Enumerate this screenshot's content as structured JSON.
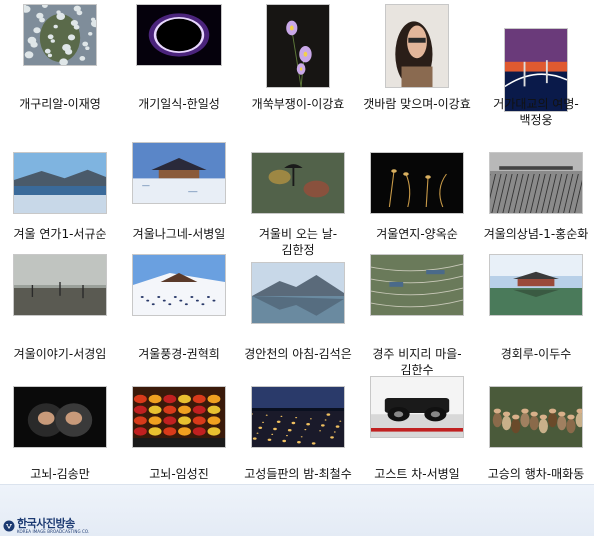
{
  "files": [
    {
      "label": "개구리알-이재영",
      "thumb": "frog-eggs"
    },
    {
      "label": "개기일식-한일성",
      "thumb": "eclipse"
    },
    {
      "label": "개쑥부쟁이-이강효",
      "thumb": "asters"
    },
    {
      "label": "갯바람 맞으며-이강효",
      "thumb": "woman-portrait"
    },
    {
      "label": "거가대교의 여명-백정웅",
      "thumb": "bridge-dawn"
    },
    {
      "label": "겨울 연가1-서규순",
      "thumb": "winter-lake"
    },
    {
      "label": "겨울나그네-서병일",
      "thumb": "snow-hanok"
    },
    {
      "label": "겨울비 오는 날-김한정",
      "thumb": "rainy-umbrella"
    },
    {
      "label": "겨울연지-양옥순",
      "thumb": "lotus-stems"
    },
    {
      "label": "겨울의상념-1-홍순화",
      "thumb": "snow-field"
    },
    {
      "label": "겨울이야기-서경임",
      "thumb": "misty-marsh"
    },
    {
      "label": "겨울풍경-권혁희",
      "thumb": "ski-slope"
    },
    {
      "label": "경안천의 아침-김석은",
      "thumb": "mountain-reflection"
    },
    {
      "label": "경주 비지리 마을-김한수",
      "thumb": "terraced-fields"
    },
    {
      "label": "경회루-이두수",
      "thumb": "gyeonghoeru"
    },
    {
      "label": "고뇌-김송만",
      "thumb": "hooded-children"
    },
    {
      "label": "고뇌-임성진",
      "thumb": "fruit-vendor"
    },
    {
      "label": "고성들판의 밤-최철수",
      "thumb": "night-plain"
    },
    {
      "label": "고스트 차-서병일",
      "thumb": "ghost-car"
    },
    {
      "label": "고승의 행차-매화동",
      "thumb": "monk-procession"
    }
  ],
  "footer": {
    "logo_name": "한국사진방송",
    "logo_sub": "KOREA IMAGE BROADCASTING CO."
  }
}
